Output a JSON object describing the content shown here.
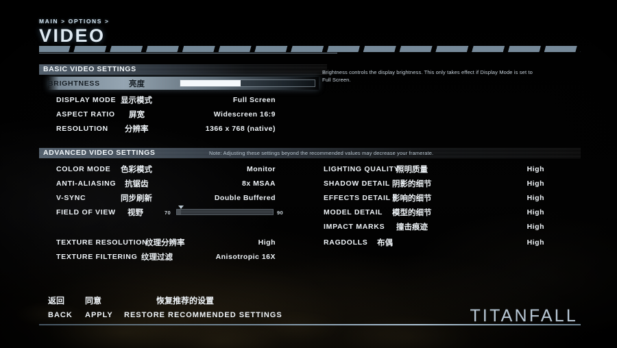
{
  "header": {
    "breadcrumb": "MAIN > OPTIONS >",
    "title": "VIDEO"
  },
  "description": "Brightness controls the display brightness. This only takes effect if Display Mode is set to Full Screen.",
  "basic_section": {
    "title": "BASIC VIDEO SETTINGS",
    "rows": [
      {
        "label_en": "BRIGHTNESS",
        "label_cn": "亮度",
        "value": "",
        "type": "slider",
        "slider_percent": 45
      },
      {
        "label_en": "DISPLAY MODE",
        "label_cn": "显示模式",
        "value": "Full Screen",
        "type": "value"
      },
      {
        "label_en": "ASPECT RATIO",
        "label_cn": "屏宽",
        "value": "Widescreen 16:9",
        "type": "value"
      },
      {
        "label_en": "RESOLUTION",
        "label_cn": "分辨率",
        "value": "1366 x 768 (native)",
        "type": "value"
      }
    ]
  },
  "advanced_section": {
    "title": "ADVANCED VIDEO SETTINGS",
    "note": "Note: Adjusting these settings beyond the recommended values may decrease your framerate.",
    "left_rows": [
      {
        "label_en": "COLOR MODE",
        "label_cn": "色彩模式",
        "value": "Monitor",
        "type": "value"
      },
      {
        "label_en": "ANTI-ALIASING",
        "label_cn": "抗锯齿",
        "value": "8x MSAA",
        "type": "value"
      },
      {
        "label_en": "V-SYNC",
        "label_cn": "同步刷新",
        "value": "Double Buffered",
        "type": "value"
      },
      {
        "label_en": "FIELD OF VIEW",
        "label_cn": "视野",
        "value": "",
        "type": "slider",
        "min_label": "70",
        "max_label": "90",
        "slider_percent": 4
      }
    ],
    "left_rows_2": [
      {
        "label_en": "TEXTURE RESOLUTION",
        "label_cn": "纹理分辨率",
        "value": "High",
        "type": "value"
      },
      {
        "label_en": "TEXTURE FILTERING",
        "label_cn": "纹理过滤",
        "value": "Anisotropic 16X",
        "type": "value"
      }
    ],
    "right_rows": [
      {
        "label_en": "LIGHTING QUALITY",
        "label_cn": "照明质量",
        "value": "High"
      },
      {
        "label_en": "SHADOW DETAIL",
        "label_cn": "阴影的细节",
        "value": "High"
      },
      {
        "label_en": "EFFECTS DETAIL",
        "label_cn": "影响的细节",
        "value": "High"
      },
      {
        "label_en": "MODEL DETAIL",
        "label_cn": "模型的细节",
        "value": "High"
      },
      {
        "label_en": "IMPACT MARKS",
        "label_cn": "撞击痕迹",
        "value": "High"
      },
      {
        "label_en": "RAGDOLLS",
        "label_cn": "布偶",
        "value": "High"
      }
    ]
  },
  "footer": {
    "back_cn": "返回",
    "back_en": "BACK",
    "apply_cn": "同意",
    "apply_en": "APPLY",
    "restore_cn": "恢复推荐的设置",
    "restore_en": "RESTORE RECOMMENDED SETTINGS"
  },
  "brand": "TITANFALL",
  "colors": {
    "accent": "#b8c8d6",
    "text": "#eef3f7",
    "highlight": "#bacede"
  }
}
